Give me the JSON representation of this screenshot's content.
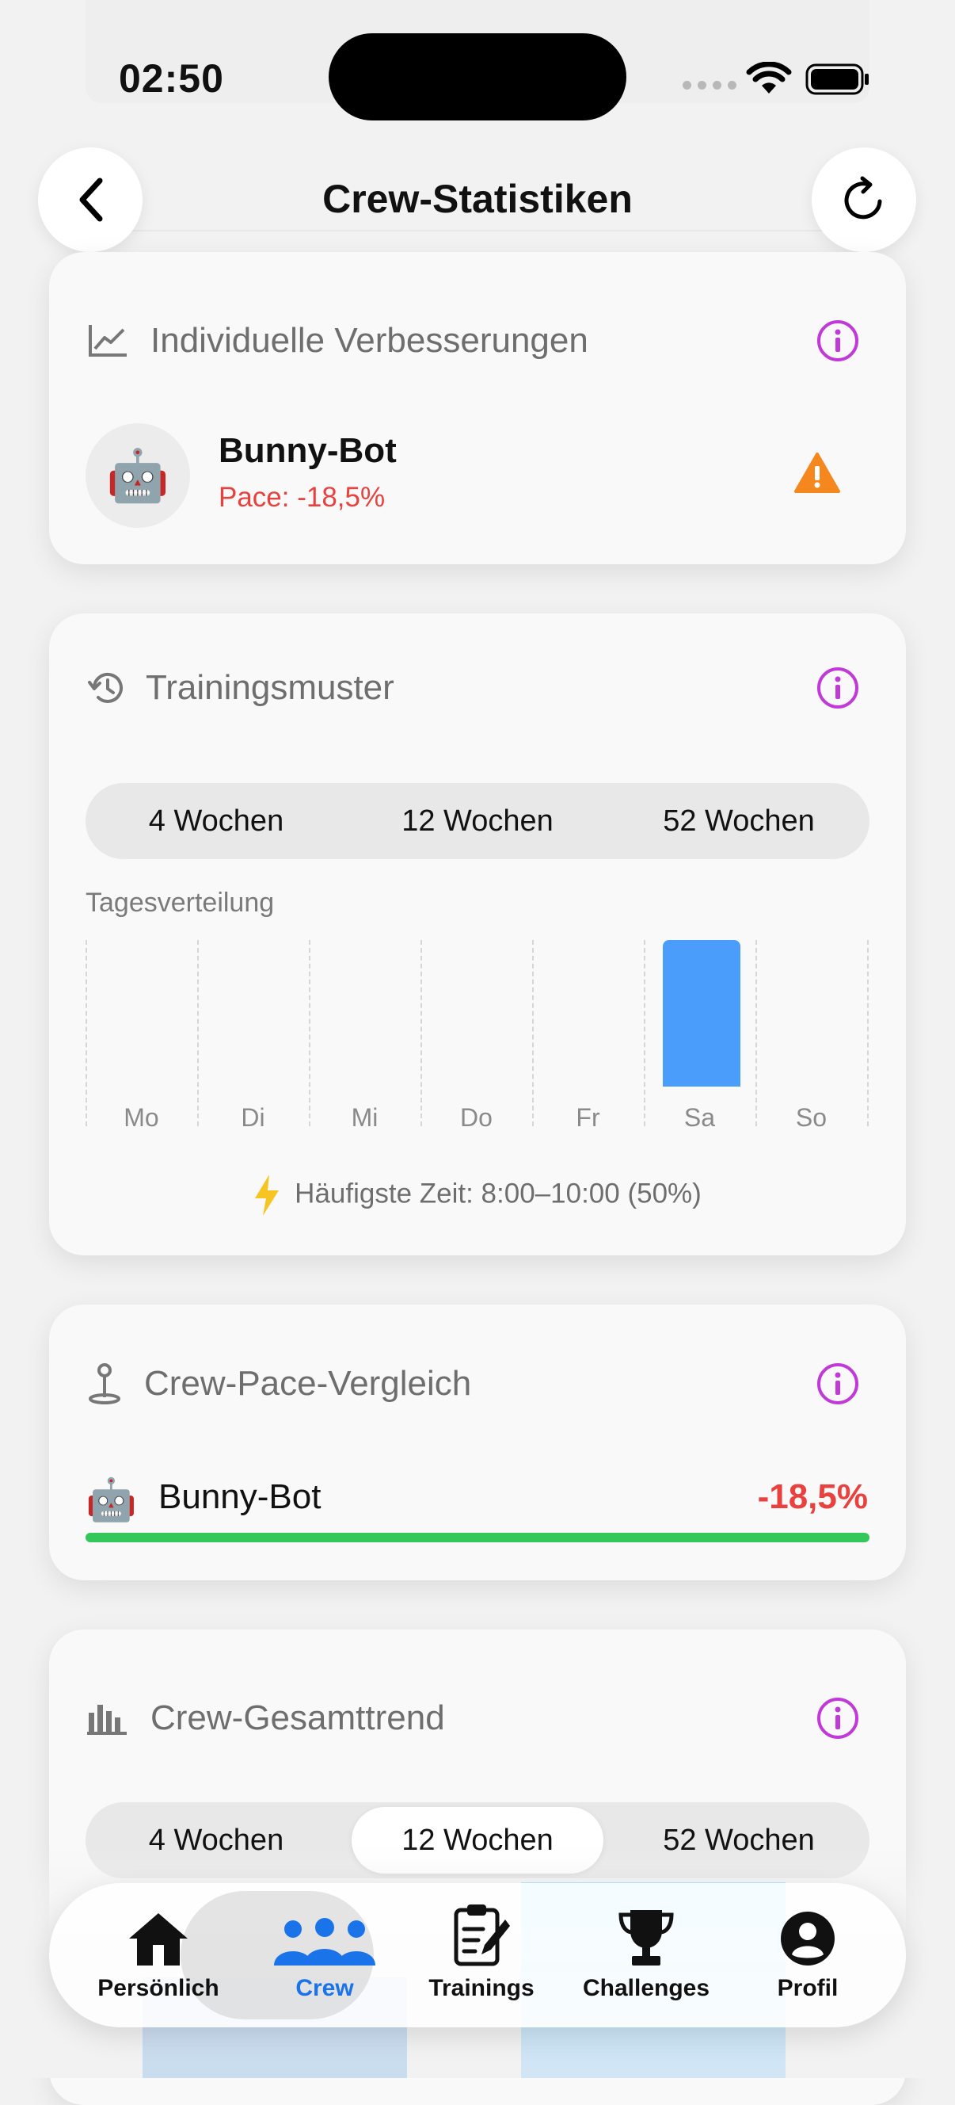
{
  "status_bar": {
    "time": "02:50"
  },
  "header": {
    "title": "Crew-Statistiken"
  },
  "improvements_card": {
    "title": "Individuelle Verbesserungen",
    "member": {
      "avatar": "🤖",
      "name": "Bunny-Bot",
      "metric": "Pace: -18,5%",
      "status_icon": "warning-icon"
    }
  },
  "training_card": {
    "title": "Trainingsmuster",
    "tabs": [
      "4 Wochen",
      "12 Wochen",
      "52 Wochen"
    ],
    "selected_tab": null,
    "chart_label": "Tagesverteilung",
    "chart_data": {
      "type": "bar",
      "categories": [
        "Mo",
        "Di",
        "Mi",
        "Do",
        "Fr",
        "Sa",
        "So"
      ],
      "values": [
        0,
        0,
        0,
        0,
        0,
        1,
        0
      ]
    },
    "hint": "Häufigste Zeit: 8:00–10:00 (50%)"
  },
  "pace_card": {
    "title": "Crew-Pace-Vergleich",
    "member": {
      "avatar": "🤖",
      "name": "Bunny-Bot",
      "value": "-18,5%"
    },
    "bar_fill_percent": 100
  },
  "trend_card": {
    "title": "Crew-Gesamttrend",
    "tabs": [
      "4 Wochen",
      "12 Wochen",
      "52 Wochen"
    ],
    "selected_tab": "12 Wochen"
  },
  "tab_bar": {
    "items": [
      {
        "label": "Persönlich",
        "icon": "house-icon"
      },
      {
        "label": "Crew",
        "icon": "people-icon"
      },
      {
        "label": "Trainings",
        "icon": "clipboard-icon"
      },
      {
        "label": "Challenges",
        "icon": "trophy-icon"
      },
      {
        "label": "Profil",
        "icon": "person-circle-icon"
      }
    ],
    "active": "Crew"
  },
  "colors": {
    "accent": "#1a73e8",
    "info": "#c13ad8",
    "warning": "#f5871f",
    "negative": "#e8413e",
    "bar": "#4b9dfb",
    "progress": "#34c759"
  }
}
